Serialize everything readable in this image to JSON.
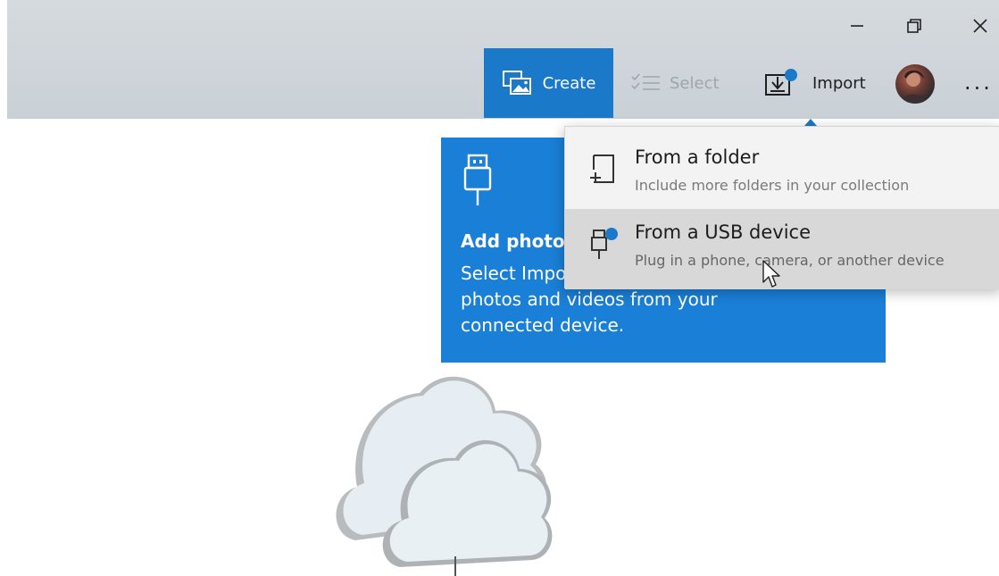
{
  "window": {
    "minimize_icon": "minimize-icon",
    "maximize_icon": "restore-icon",
    "close_icon": "close-icon"
  },
  "toolbar": {
    "create_label": "Create",
    "select_label": "Select",
    "import_label": "Import",
    "more_label": "...",
    "create_icon": "slideshow-icon",
    "select_icon": "checklist-icon",
    "import_icon": "import-icon",
    "accent": "#1a79c9"
  },
  "tip": {
    "title": "Add photo",
    "body": "Select Import\nphotos and videos from your\nconnected device.",
    "icon": "usb-icon",
    "background": "#1a7fd6"
  },
  "import_menu": {
    "items": [
      {
        "title": "From a folder",
        "subtitle": "Include more folders in your collection",
        "icon": "folder-add-icon"
      },
      {
        "title": "From a USB device",
        "subtitle": "Plug in a phone, camera, or another device",
        "icon": "usb-device-icon"
      }
    ]
  }
}
